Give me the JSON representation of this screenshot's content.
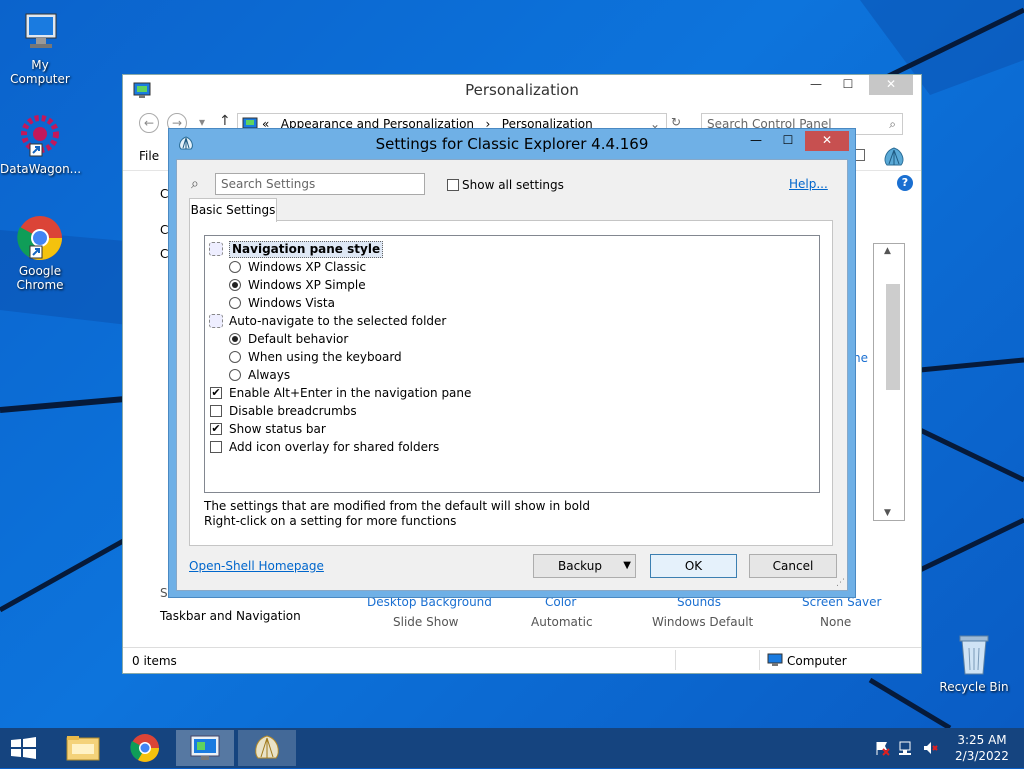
{
  "desktop": {
    "icons": [
      {
        "label": "My Computer"
      },
      {
        "label": "DataWagon..."
      },
      {
        "label": "Google Chrome"
      },
      {
        "label": "Recycle Bin"
      }
    ]
  },
  "explorer": {
    "title": "Personalization",
    "breadcrumb": [
      "«",
      "Appearance and Personalization",
      "›",
      "Personalization"
    ],
    "search_placeholder": "Search Control Panel",
    "menu_file": "File",
    "section_label": "Taskbar and Navigation",
    "bottom_items": [
      {
        "name": "Desktop Background",
        "value": "Slide Show"
      },
      {
        "name": "Color",
        "value": "Automatic"
      },
      {
        "name": "Sounds",
        "value": "Windows Default"
      },
      {
        "name": "Screen Saver",
        "value": "None"
      }
    ],
    "status_items": "0 items",
    "status_location": "Computer",
    "left_letters": [
      "C",
      "C",
      "C",
      "Se"
    ],
    "right_fragment": "ne"
  },
  "dialog": {
    "title": "Settings for Classic Explorer 4.4.169",
    "search_placeholder": "Search Settings",
    "show_all_label": "Show all settings",
    "help_link": "Help...",
    "tab_label": "Basic Settings",
    "settings": [
      {
        "type": "group",
        "label": "Navigation pane style",
        "bold": true
      },
      {
        "type": "radio",
        "label": "Windows XP Classic",
        "checked": false
      },
      {
        "type": "radio",
        "label": "Windows XP Simple",
        "checked": true
      },
      {
        "type": "radio",
        "label": "Windows Vista",
        "checked": false
      },
      {
        "type": "group",
        "label": "Auto-navigate to the selected folder",
        "bold": false
      },
      {
        "type": "radio",
        "label": "Default behavior",
        "checked": true
      },
      {
        "type": "radio",
        "label": "When using the keyboard",
        "checked": false
      },
      {
        "type": "radio",
        "label": "Always",
        "checked": false
      },
      {
        "type": "check",
        "label": "Enable Alt+Enter in the navigation pane",
        "checked": true
      },
      {
        "type": "check",
        "label": "Disable breadcrumbs",
        "checked": false
      },
      {
        "type": "check",
        "label": "Show status bar",
        "checked": true
      },
      {
        "type": "check",
        "label": "Add icon overlay for shared folders",
        "checked": false
      }
    ],
    "hint_line1": "The settings that are modified from the default will show in bold",
    "hint_line2": "Right-click on a setting for more functions",
    "homepage_link": "Open-Shell Homepage",
    "backup_label": "Backup",
    "ok_label": "OK",
    "cancel_label": "Cancel"
  },
  "taskbar": {
    "time": "3:25 AM",
    "date": "2/3/2022"
  },
  "colors": {
    "desktop_blue": "#0b63cc",
    "dialog_frame": "#6fb0e6",
    "close_red": "#c75050",
    "taskbar": "#15447f"
  }
}
